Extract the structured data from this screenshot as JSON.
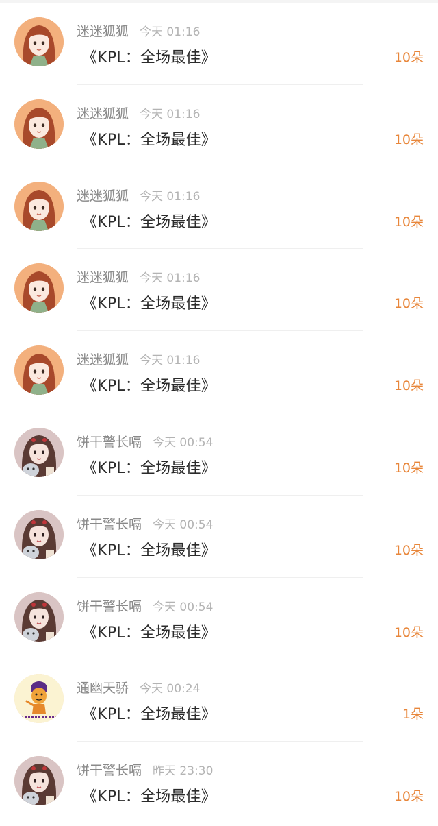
{
  "colors": {
    "amount": "#e8863a",
    "name": "#8a8a8a",
    "time": "#b3b3b3",
    "gift": "#2b2b2b"
  },
  "rows": [
    {
      "name": "迷迷狐狐",
      "time": "今天 01:16",
      "gift": "《KPL：全场最佳》",
      "amount": "10朵",
      "avatar": "red-hair-girl-avatar"
    },
    {
      "name": "迷迷狐狐",
      "time": "今天 01:16",
      "gift": "《KPL：全场最佳》",
      "amount": "10朵",
      "avatar": "red-hair-girl-avatar"
    },
    {
      "name": "迷迷狐狐",
      "time": "今天 01:16",
      "gift": "《KPL：全场最佳》",
      "amount": "10朵",
      "avatar": "red-hair-girl-avatar"
    },
    {
      "name": "迷迷狐狐",
      "time": "今天 01:16",
      "gift": "《KPL：全场最佳》",
      "amount": "10朵",
      "avatar": "red-hair-girl-avatar"
    },
    {
      "name": "迷迷狐狐",
      "time": "今天 01:16",
      "gift": "《KPL：全场最佳》",
      "amount": "10朵",
      "avatar": "red-hair-girl-avatar"
    },
    {
      "name": "饼干警长嗝",
      "time": "今天 00:54",
      "gift": "《KPL：全场最佳》",
      "amount": "10朵",
      "avatar": "girl-with-cat-avatar"
    },
    {
      "name": "饼干警长嗝",
      "time": "今天 00:54",
      "gift": "《KPL：全场最佳》",
      "amount": "10朵",
      "avatar": "girl-with-cat-avatar"
    },
    {
      "name": "饼干警长嗝",
      "time": "今天 00:54",
      "gift": "《KPL：全场最佳》",
      "amount": "10朵",
      "avatar": "girl-with-cat-avatar"
    },
    {
      "name": "通幽天骄",
      "time": "今天 00:24",
      "gift": "《KPL：全场最佳》",
      "amount": "1朵",
      "avatar": "cartoon-meme-avatar"
    },
    {
      "name": "饼干警长嗝",
      "time": "昨天 23:30",
      "gift": "《KPL：全场最佳》",
      "amount": "10朵",
      "avatar": "girl-with-cat-avatar"
    }
  ]
}
